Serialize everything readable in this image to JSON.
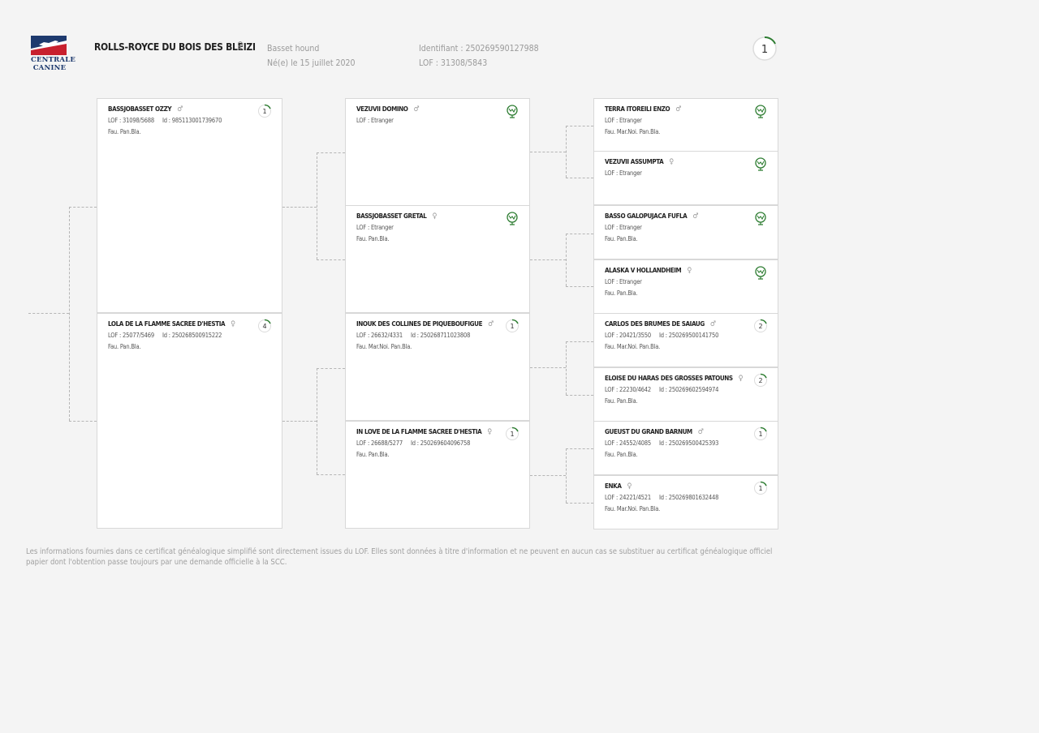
{
  "header": {
    "logo_text_1": "CENTRALE",
    "logo_text_2": "CANINE",
    "dog_name": "ROLLS-ROYCE DU BOIS DES BLEIZI",
    "dog_sex": "♀",
    "breed": "Basset hound",
    "birth": "Né(e) le 15 juillet 2020",
    "identifier": "Identifiant : 250269590127988",
    "lof": "LOF : 31308/5843",
    "generation_badge": "1"
  },
  "parents": [
    {
      "name": "BASSJOBASSET OZZY",
      "sex": "♂",
      "lof": "LOF : 31098/5688",
      "id": "Id : 985113001739670",
      "colors": "Fau. Pan.Bla.",
      "badge": "1",
      "badge_type": "gen"
    },
    {
      "name": "LOLA DE LA FLAMME SACREE D'HESTIA",
      "sex": "♀",
      "lof": "LOF : 25077/5469",
      "id": "Id : 250268500915222",
      "colors": "Fau. Pan.Bla.",
      "badge": "4",
      "badge_type": "gen"
    }
  ],
  "grandparents": [
    {
      "name": "VEZUVII DOMINO",
      "sex": "♂",
      "lof": "LOF : Etranger",
      "id": "",
      "colors": "",
      "badge": "",
      "badge_type": "foreign"
    },
    {
      "name": "BASSJOBASSET GRETAL",
      "sex": "♀",
      "lof": "LOF : Etranger",
      "id": "",
      "colors": "Fau. Pan.Bla.",
      "badge": "",
      "badge_type": "foreign"
    },
    {
      "name": "INOUK DES COLLINES DE PIQUEBOUFIGUE",
      "sex": "♂",
      "lof": "LOF : 26632/4331",
      "id": "Id : 250268711023808",
      "colors": "Fau. Mar.Noi. Pan.Bla.",
      "badge": "1",
      "badge_type": "gen"
    },
    {
      "name": "IN LOVE DE LA FLAMME SACREE D'HESTIA",
      "sex": "♀",
      "lof": "LOF : 26688/5277",
      "id": "Id : 250269604096758",
      "colors": "Fau. Pan.Bla.",
      "badge": "1",
      "badge_type": "gen"
    }
  ],
  "great_grandparents": [
    {
      "name": "TERRA ITOREILI ENZO",
      "sex": "♂",
      "lof": "LOF : Etranger",
      "id": "",
      "colors": "Fau. Mar.Noi. Pan.Bla.",
      "badge": "",
      "badge_type": "foreign"
    },
    {
      "name": "VEZUVII ASSUMPTA",
      "sex": "♀",
      "lof": "LOF : Etranger",
      "id": "",
      "colors": "",
      "badge": "",
      "badge_type": "foreign"
    },
    {
      "name": "BASSO GALOPUJACA FUFLA",
      "sex": "♂",
      "lof": "LOF : Etranger",
      "id": "",
      "colors": "Fau. Pan.Bla.",
      "badge": "",
      "badge_type": "foreign"
    },
    {
      "name": "ALASKA V HOLLANDHEIM",
      "sex": "♀",
      "lof": "LOF : Etranger",
      "id": "",
      "colors": "Fau. Pan.Bla.",
      "badge": "",
      "badge_type": "foreign"
    },
    {
      "name": "CARLOS DES BRUMES DE SAIAUG",
      "sex": "♂",
      "lof": "LOF : 20421/3550",
      "id": "Id : 250269500141750",
      "colors": "Fau. Mar.Noi. Pan.Bla.",
      "badge": "2",
      "badge_type": "gen"
    },
    {
      "name": "ELOISE DU HARAS DES GROSSES PATOUNS",
      "sex": "♀",
      "lof": "LOF : 22230/4642",
      "id": "Id : 250269602594974",
      "colors": "Fau. Pan.Bla.",
      "badge": "2",
      "badge_type": "gen"
    },
    {
      "name": "GUEUST DU GRAND BARNUM",
      "sex": "♂",
      "lof": "LOF : 24552/4085",
      "id": "Id : 250269500425393",
      "colors": "Fau. Pan.Bla.",
      "badge": "1",
      "badge_type": "gen"
    },
    {
      "name": "ENKA",
      "sex": "♀",
      "lof": "LOF : 24221/4521",
      "id": "Id : 250269801632448",
      "colors": "Fau. Mar.Noi. Pan.Bla.",
      "badge": "1",
      "badge_type": "gen"
    }
  ],
  "footer": {
    "line1": "Les informations fournies dans ce certificat généalogique simplifié sont directement issues du LOF. Elles sont données à titre d'information et ne peuvent en aucun cas se substituer au certificat généalogique officiel",
    "line2": "papier dont l'obtention passe toujours par une demande officielle à la SCC."
  },
  "colors": {
    "badge_green": "#2e7d32",
    "border": "#d8d8d8",
    "logo_blue": "#1e3a6e",
    "logo_red": "#c8202e"
  },
  "icons": {
    "foreign": "globe-icon",
    "generation": "generation-progress-icon"
  }
}
